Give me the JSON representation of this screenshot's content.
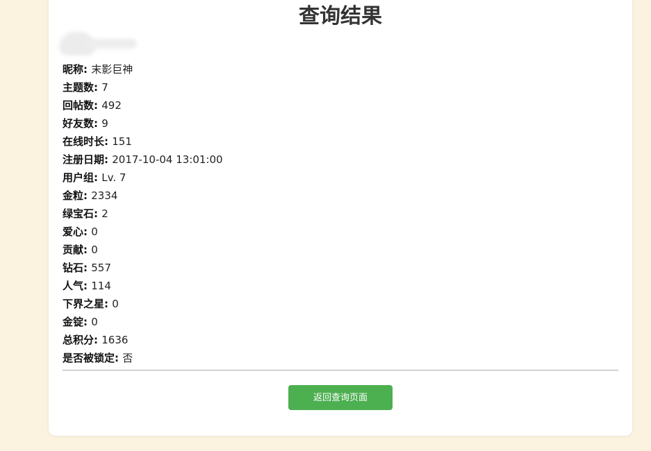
{
  "page": {
    "title": "查询结果"
  },
  "fields": [
    {
      "label": "昵称",
      "value": "末影巨神"
    },
    {
      "label": "主题数",
      "value": "7"
    },
    {
      "label": "回帖数",
      "value": "492"
    },
    {
      "label": "好友数",
      "value": "9"
    },
    {
      "label": "在线时长",
      "value": "151"
    },
    {
      "label": "注册日期",
      "value": "2017-10-04 13:01:00"
    },
    {
      "label": "用户组",
      "value": "Lv. 7"
    },
    {
      "label": "金粒",
      "value": "2334"
    },
    {
      "label": "绿宝石",
      "value": "2"
    },
    {
      "label": "爱心",
      "value": "0"
    },
    {
      "label": "贡献",
      "value": "0"
    },
    {
      "label": "钻石",
      "value": "557"
    },
    {
      "label": "人气",
      "value": "114"
    },
    {
      "label": "下界之星",
      "value": "0"
    },
    {
      "label": "金锭",
      "value": "0"
    },
    {
      "label": "总积分",
      "value": "1636"
    },
    {
      "label": "是否被锁定",
      "value": "否"
    }
  ],
  "actions": {
    "back_label": "返回查询页面"
  },
  "colors": {
    "background": "#fbf2df",
    "card": "#ffffff",
    "button": "#4caf50"
  }
}
